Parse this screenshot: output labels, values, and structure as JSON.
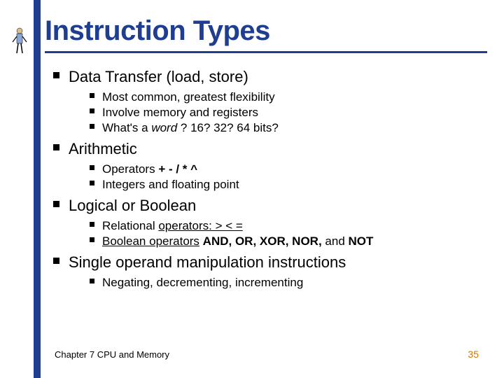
{
  "slide": {
    "title": "Instruction Types",
    "items": [
      {
        "label": "Data Transfer (load, store)",
        "sub": [
          {
            "html": "Most common, greatest flexibility"
          },
          {
            "html": "Involve memory and registers"
          },
          {
            "html": "What's a <span class='ital'>word</span> ?  16? 32? 64 bits?"
          }
        ]
      },
      {
        "label": "Arithmetic",
        "sub": [
          {
            "html": "Operators <span class='bold'>+ - / * ^</span>"
          },
          {
            "html": "Integers and floating point"
          }
        ]
      },
      {
        "label": "Logical or Boolean",
        "sub": [
          {
            "html": "Relational <span class='uline'>operators:  &gt;  &lt;  =</span>"
          },
          {
            "html": "<span class='uline'>Boolean operators</span> <span class='bold'>AND, OR, XOR, NOR,</span> and <span class='bold'>NOT</span>"
          }
        ]
      },
      {
        "label": "Single operand manipulation instructions",
        "sub": [
          {
            "html": "Negating, decrementing, incrementing"
          }
        ]
      }
    ]
  },
  "footer": {
    "chapter": "Chapter 7 CPU and Memory",
    "page": "35"
  }
}
